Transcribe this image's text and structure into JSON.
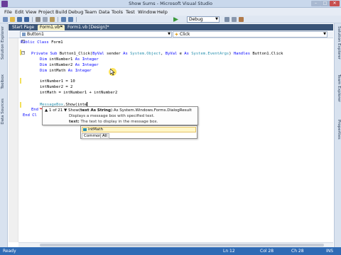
{
  "window": {
    "title": "Show Sums - Microsoft Visual Studio",
    "controls": [
      "–",
      "□",
      "✕"
    ]
  },
  "menu": [
    "File",
    "Edit",
    "View",
    "Project",
    "Build",
    "Debug",
    "Team",
    "Data",
    "Tools",
    "Test",
    "Window",
    "Help"
  ],
  "toolbar": {
    "configuration": "Debug"
  },
  "side_windows": {
    "left": [
      "Solution Explorer",
      "Toolbox",
      "Data Sources"
    ],
    "right": [
      "Solution Explorer",
      "Team Explorer",
      "Properties"
    ]
  },
  "tabs": [
    {
      "label": "Start Page",
      "active": false
    },
    {
      "label": "Form1.vb*",
      "active": true
    },
    {
      "label": "Form1.vb [Design]*",
      "active": false
    }
  ],
  "navbar": {
    "object": "Button1",
    "event": "Click"
  },
  "code": {
    "class_open": [
      "Public ",
      "Class ",
      "Form1"
    ],
    "sub_decl": {
      "kw1": "Private Sub ",
      "name": "Button1_Click(",
      "kw2": "ByVal ",
      "p1": "sender ",
      "kw3": "As ",
      "t1": "System.Object",
      "sep": ", ",
      "kw4": "ByVal ",
      "p2": "e ",
      "kw5": "As ",
      "t2": "System.EventArgs",
      "close": ") ",
      "kw6": "Handles ",
      "handler": "Button1.Click"
    },
    "dims": [
      {
        "kw": "Dim ",
        "name": "intNumber1 ",
        "as": "As ",
        "type": "Integer"
      },
      {
        "kw": "Dim ",
        "name": "intNumber2 ",
        "as": "As ",
        "type": "Integer"
      },
      {
        "kw": "Dim ",
        "name": "intMath ",
        "as": "As ",
        "type": "Integer"
      }
    ],
    "assigns": [
      "intNumber1 = 10",
      "intNumber2 = 2",
      "intMath = intNumber1 + intNumber2"
    ],
    "call": {
      "object": "MessageBox",
      "rest": ".Show(inte"
    },
    "end_sub": "End",
    "end_class": "End Cl"
  },
  "param_info": {
    "counter": "1 of 21",
    "method": "Show(",
    "param": "text As String",
    "returns": ") As System.Windows.Forms.DialogResult",
    "summary": "Displays a message box with specified text.",
    "param_name": "text:",
    "param_desc": "The text to display in the message box."
  },
  "completion": {
    "item": "intMath",
    "tabs": [
      "Common",
      "All"
    ]
  },
  "statusbar": {
    "state": "Ready",
    "line": "Ln 12",
    "col": "Col 28",
    "ch": "Ch 28",
    "mode": "INS"
  },
  "colors": {
    "keyword": "#0000ff",
    "type": "#2b91af",
    "status_bar": "#2f6bb5",
    "tab_strip": "#3a5477",
    "active_tab": "#f5f0c8"
  },
  "icons": [
    "app-icon",
    "new-project-icon",
    "open-file-icon",
    "save-icon",
    "save-all-icon",
    "cut-icon",
    "copy-icon",
    "paste-icon",
    "undo-icon",
    "redo-icon",
    "start-debug-icon",
    "find-icon",
    "properties-icon",
    "toolbox-icon",
    "button-object-icon",
    "event-lightning-icon",
    "mouse-cursor-icon",
    "local-variable-icon"
  ]
}
